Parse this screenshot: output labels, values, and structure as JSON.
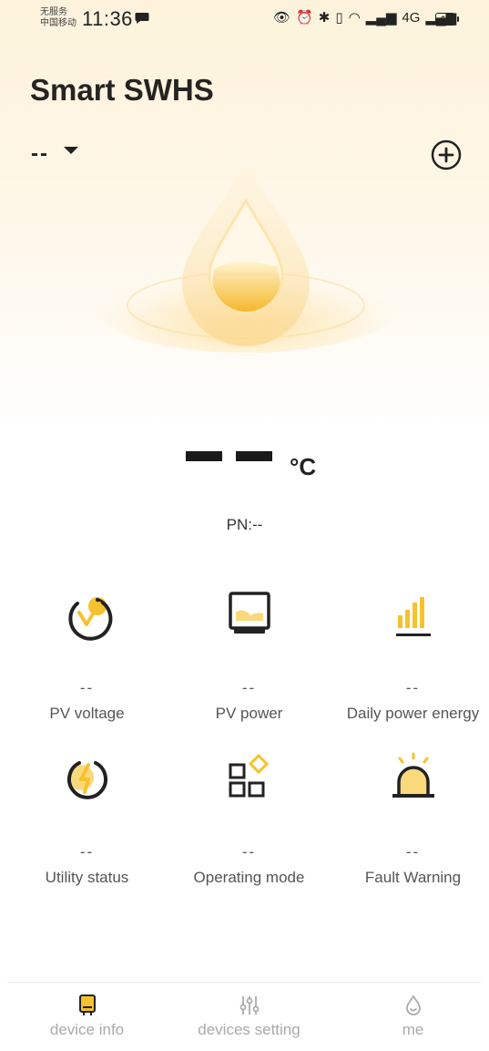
{
  "status_bar": {
    "carrier_line1": "无服务",
    "carrier_line2": "中国移动",
    "time": "11:36",
    "network_badge": "4G",
    "battery": "68"
  },
  "app": {
    "title": "Smart SWHS"
  },
  "device_selector": {
    "value": "--"
  },
  "temperature": {
    "unit": "°C"
  },
  "pn": "PN:--",
  "metrics": [
    {
      "label": "PV voltage",
      "value": "--"
    },
    {
      "label": "PV power",
      "value": "--"
    },
    {
      "label": "Daily power energy",
      "value": "--"
    },
    {
      "label": "Utility status",
      "value": "--"
    },
    {
      "label": "Operating mode",
      "value": "--"
    },
    {
      "label": "Fault Warning",
      "value": "--"
    }
  ],
  "tabs": [
    {
      "label": "device info",
      "active": true
    },
    {
      "label": "devices setting",
      "active": false
    },
    {
      "label": "me",
      "active": false
    }
  ],
  "colors": {
    "accent": "#f6c22d",
    "text": "#262321",
    "muted": "#aaaaaa"
  }
}
